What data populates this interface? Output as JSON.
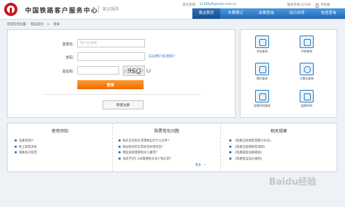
{
  "header": {
    "site_title": "中国铁路客户服务中心",
    "site_subtitle": "客运服务",
    "welcome_prefix": "意见反馈:",
    "email": "12306yfk@rails.com.cn",
    "service_tel": "服务热线:12306",
    "phone_label": "手机版"
  },
  "nav": {
    "items": [
      "客运首页",
      "车票预订",
      "余票查询",
      "出行向导",
      "信息查询"
    ],
    "active_index": 0
  },
  "breadcrumb": {
    "prefix": "您现在的位置:",
    "home": "客运首页",
    "separator": ">",
    "current": "登录"
  },
  "login": {
    "username_label": "登录名:",
    "username_placeholder": "用户名/邮箱",
    "password_label": "密码:",
    "forgot_link": "忘记用户名/密码?",
    "captcha_label": "验证码:",
    "captcha_text": "9SQ",
    "login_button": "登录",
    "quick_register_button": "快速注册"
  },
  "services": [
    {
      "label": "车站查询",
      "icon": "station-icon"
    },
    {
      "label": "中转查询",
      "icon": "transfer-icon"
    },
    {
      "label": "票价查询",
      "icon": "price-icon"
    },
    {
      "label": "正晚点查询",
      "icon": "clock-icon"
    },
    {
      "label": "发售时间查询",
      "icon": "sale-time-icon"
    },
    {
      "label": "起售时间",
      "icon": "calendar-icon"
    }
  ],
  "info": {
    "col1_title": "使用须知",
    "col1_items": [
      "注册新用户",
      "网上购票流程",
      "铁路电子客票"
    ],
    "col2_title": "购票常见问题",
    "col2_items": [
      "购买实名制车票需要出示什么证件?",
      "网站购买的车票如何办理改签?",
      "哪些旅客需要购买儿童票?",
      "身高不足1.2米需要购买多少钱车票?"
    ],
    "more": "更多",
    "more_arrow": "»",
    "col3_title": "相关规章",
    "col3_items": [
      "《铁路互联网售票暂行办法》",
      "《铁路互联网购票须知》",
      "《铁路旅客运输规程》",
      "《铁路客运运价规则》"
    ]
  },
  "watermark": "Baidu经验",
  "colors": {
    "nav_blue": "#1f67b6",
    "login_orange": "#f06b00",
    "link_blue": "#2a6fc9",
    "logo_red": "#c9151e"
  }
}
